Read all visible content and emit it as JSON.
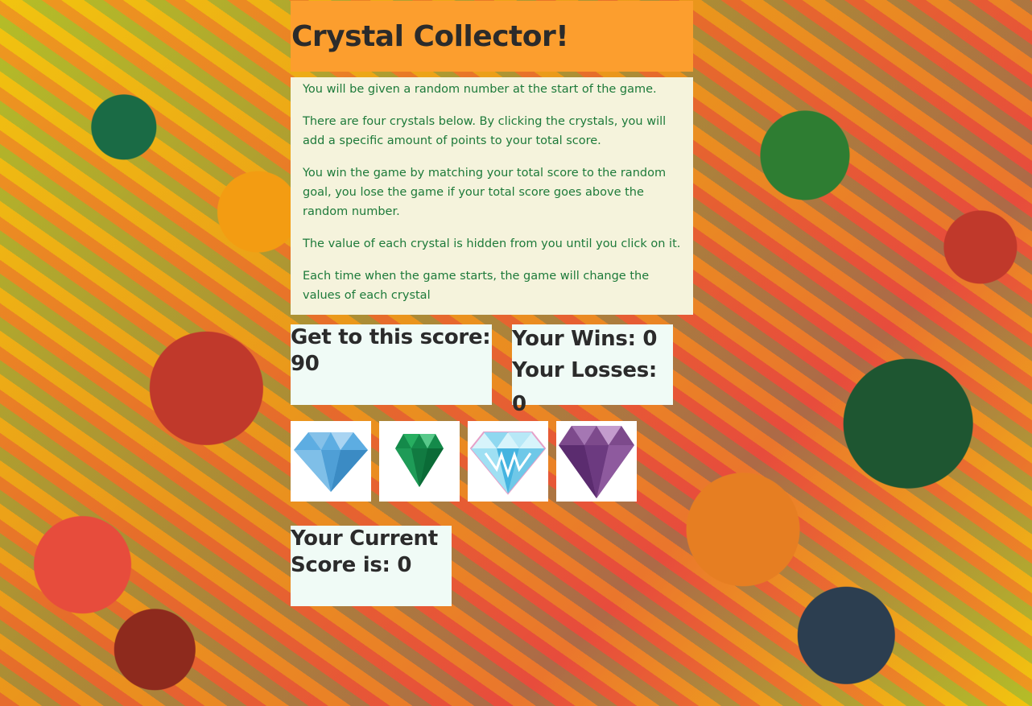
{
  "title": "Crystal Collector!",
  "instructions": [
    "You will be given a random number at the start of the game.",
    "There are four crystals below. By clicking the crystals, you will add a specific amount of points to your total score.",
    "You win the game by matching your total score to the random goal, you lose the game if your total score goes above the random number.",
    "The value of each crystal is hidden from you until you click on it.",
    "Each time when the game starts, the game will change the values of each crystal"
  ],
  "target": {
    "label": "Get to this score:",
    "value": "90"
  },
  "record": {
    "wins_label": "Your Wins: 0",
    "losses_label": "Your Losses: 0"
  },
  "crystals": [
    {
      "name": "blue-diamond-icon",
      "color": "#5dade2"
    },
    {
      "name": "green-emerald-icon",
      "color": "#148a4a"
    },
    {
      "name": "rainbow-diamond-icon",
      "color": "#8fd8f0"
    },
    {
      "name": "purple-amethyst-icon",
      "color": "#7d4a8c"
    }
  ],
  "current_score": {
    "label": "Your Current Score is: 0"
  }
}
